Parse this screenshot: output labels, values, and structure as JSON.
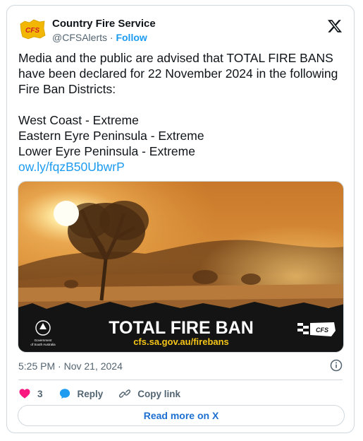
{
  "author": {
    "name": "Country Fire Service",
    "handle": "@CFSAlerts",
    "separator": "·",
    "follow_label": "Follow",
    "avatar_text": "CFS"
  },
  "tweet": {
    "line1": "Media and the public are advised that TOTAL FIRE BANS have been declared for 22 November 2024 in the following Fire Ban Districts:",
    "districts": [
      "West Coast - Extreme",
      "Eastern Eyre Peninsula - Extreme",
      "Lower Eyre Peninsula - Extreme"
    ],
    "link": "ow.ly/fqzB50UbwrP"
  },
  "media": {
    "headline": "TOTAL FIRE BAN",
    "url": "cfs.sa.gov.au/firebans",
    "gov_line1": "Government",
    "gov_line2": "of South Australia",
    "logo_text": "CFS"
  },
  "timestamp": "5:25 PM · Nov 21, 2024",
  "actions": {
    "likes": "3",
    "reply_label": "Reply",
    "copy_label": "Copy link"
  },
  "read_more_label": "Read more on X",
  "colors": {
    "link_blue": "#1d9bf0",
    "heart_red": "#f91880",
    "banner_yellow": "#f5c518",
    "banner_black": "#141414"
  },
  "icons": [
    "cfs-avatar-icon",
    "x-logo-icon",
    "info-icon",
    "heart-icon",
    "reply-icon",
    "link-icon"
  ]
}
